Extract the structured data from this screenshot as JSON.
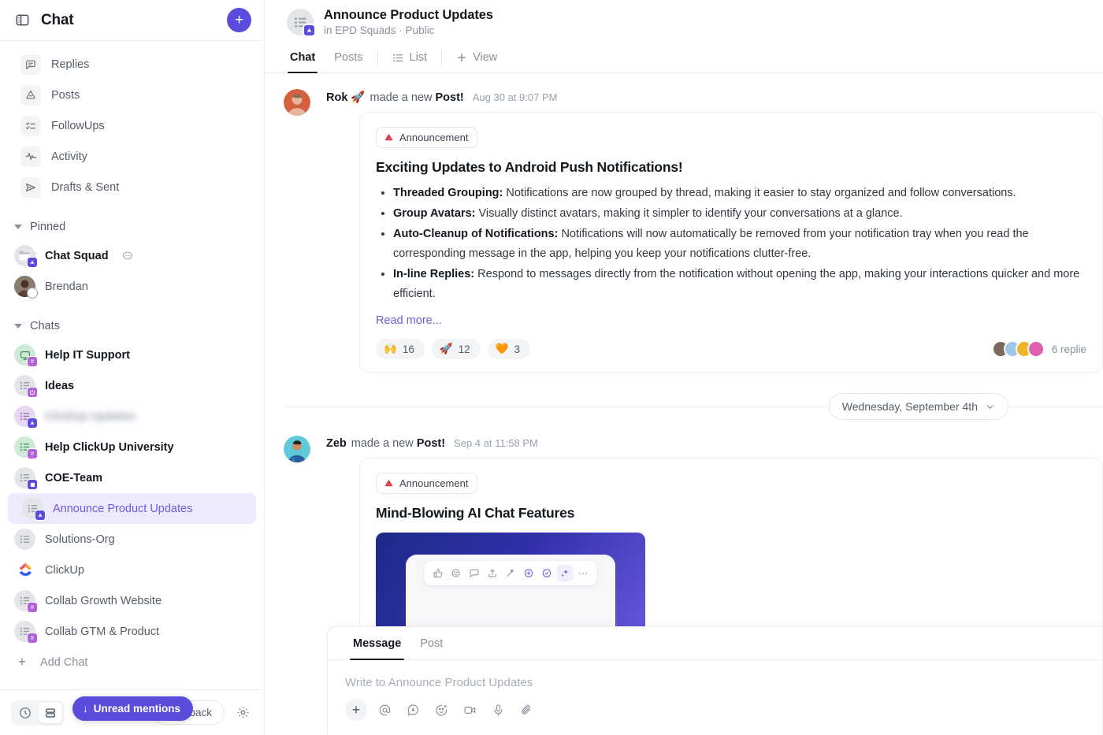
{
  "sidebar": {
    "panel_toggle_icon": "panel-left-icon",
    "title": "Chat",
    "new_button_label": "+",
    "nav_items": [
      {
        "label": "Replies",
        "icon": "reply-bubble-icon"
      },
      {
        "label": "Posts",
        "icon": "megaphone-icon"
      },
      {
        "label": "FollowUps",
        "icon": "checklist-icon"
      },
      {
        "label": "Activity",
        "icon": "activity-pulse-icon"
      },
      {
        "label": "Drafts & Sent",
        "icon": "paper-plane-icon"
      }
    ],
    "pinned_section": {
      "label": "Pinned"
    },
    "pinned_items": [
      {
        "label": "Chat Squad",
        "bold": true,
        "badge": "clickup",
        "trailing_icon": "speech-bubble-icon"
      },
      {
        "label": "Brendan",
        "bold": false,
        "badge": "status"
      }
    ],
    "chats_section": {
      "label": "Chats"
    },
    "chat_items": [
      {
        "label": "Help IT Support",
        "bold": true,
        "avatar": "green",
        "badge": "hash"
      },
      {
        "label": "Ideas",
        "bold": true,
        "avatar": "grey",
        "badge": "power"
      },
      {
        "label": "ClickUp Updates",
        "bold": true,
        "avatar": "purple",
        "badge": "clickup",
        "blurred": true
      },
      {
        "label": "Help ClickUp University",
        "bold": true,
        "avatar": "green",
        "badge": "hash"
      },
      {
        "label": "COE-Team",
        "bold": true,
        "avatar": "grey",
        "badge": "square"
      },
      {
        "label": "Announce Product Updates",
        "bold": false,
        "avatar": "grey",
        "badge": "clickup",
        "active": true
      },
      {
        "label": "Solutions-Org",
        "bold": false,
        "avatar": "grey",
        "badge": "none"
      },
      {
        "label": "ClickUp",
        "bold": false,
        "avatar": "logo",
        "badge": "none"
      },
      {
        "label": "Collab Growth Website",
        "bold": false,
        "avatar": "grey",
        "badge": "hash"
      },
      {
        "label": "Collab GTM & Product",
        "bold": false,
        "avatar": "grey",
        "badge": "hash"
      }
    ],
    "add_chat_label": "Add Chat",
    "unread_mentions_label": "Unread mentions",
    "footer": {
      "history_icon": "clock-icon",
      "list_view_icon": "rows-icon",
      "feedback_label": "Feedback",
      "settings_icon": "gear-icon"
    }
  },
  "header": {
    "title": "Announce Product Updates",
    "subtitle": "in EPD Squads · Public",
    "tabs": [
      {
        "label": "Chat",
        "active": true
      },
      {
        "label": "Posts",
        "active": false
      },
      {
        "label": "List",
        "active": false,
        "icon": "list-icon"
      },
      {
        "label": "View",
        "active": false,
        "icon": "plus-icon"
      }
    ]
  },
  "messages": {
    "posts": [
      {
        "author": "Rok 🚀",
        "action_prefix": "made a new ",
        "action_bold": "Post!",
        "time": "Aug 30 at 9:07 PM",
        "tag": "Announcement",
        "tag_icon": "megaphone-red-icon",
        "title": "Exciting Updates to Android Push Notifications!",
        "bullets": [
          {
            "lead": "Threaded Grouping:",
            "text": " Notifications are now grouped by thread, making it easier to stay organized and follow conversations."
          },
          {
            "lead": "Group Avatars:",
            "text": " Visually distinct avatars, making it simpler to identify your conversations at a glance."
          },
          {
            "lead": "Auto-Cleanup of Notifications:",
            "text": " Notifications will now automatically be removed from your notification tray when you read the corresponding message in the app, helping you keep your notifications clutter-free."
          },
          {
            "lead": "In-line Replies:",
            "text": " Respond to messages directly from the notification without opening the app, making your interactions quicker and more efficient."
          }
        ],
        "read_more": "Read more...",
        "reactions": [
          {
            "emoji": "🙌",
            "count": "16"
          },
          {
            "emoji": "🚀",
            "count": "12"
          },
          {
            "emoji": "🧡",
            "count": "3"
          }
        ],
        "replies_label": "6 replie"
      },
      {
        "author": "Zeb",
        "action_prefix": "made a new ",
        "action_bold": "Post!",
        "time": "Sep 4 at 11:58 PM",
        "tag": "Announcement",
        "tag_icon": "megaphone-red-icon",
        "title": "Mind-Blowing AI Chat Features"
      }
    ],
    "date_divider": {
      "label": "Wednesday, September 4th",
      "chevron_icon": "chevron-down-icon"
    }
  },
  "composer": {
    "tabs": [
      {
        "label": "Message",
        "active": true
      },
      {
        "label": "Post",
        "active": false
      }
    ],
    "placeholder": "Write to Announce Product Updates",
    "tools": [
      {
        "icon": "plus-icon"
      },
      {
        "icon": "mention-at-icon"
      },
      {
        "icon": "ai-bubble-icon"
      },
      {
        "icon": "emoji-icon"
      },
      {
        "icon": "video-icon"
      },
      {
        "icon": "microphone-icon"
      },
      {
        "icon": "attachment-clip-icon"
      }
    ]
  },
  "colors": {
    "accent": "#5b4cdb",
    "active_chat_text": "#6c5ce0",
    "active_chat_bg": "#eceafc",
    "announcement_red": "#e0394a"
  }
}
